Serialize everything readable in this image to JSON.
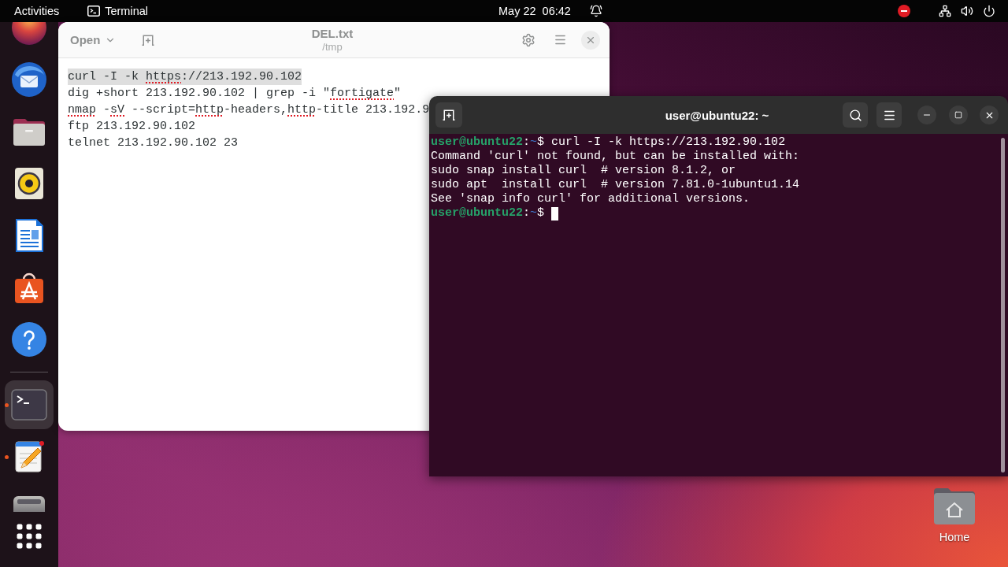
{
  "top_bar": {
    "activities": "Activities",
    "app": "Terminal",
    "date": "May 22",
    "time": "06:42"
  },
  "dock": {
    "pinned": [
      {
        "kind": "orb",
        "running": false,
        "selected": false
      },
      {
        "kind": "mail",
        "running": false,
        "selected": false
      },
      {
        "kind": "folder",
        "running": false,
        "selected": false
      },
      {
        "kind": "speaker",
        "running": false,
        "selected": false
      },
      {
        "kind": "document",
        "running": false,
        "selected": false
      },
      {
        "kind": "store",
        "running": false,
        "selected": false
      },
      {
        "kind": "help",
        "running": false,
        "selected": false
      }
    ],
    "others": [
      {
        "kind": "terminal",
        "running": true,
        "selected": true
      },
      {
        "kind": "notepad",
        "running": true,
        "selected": false
      },
      {
        "kind": "drive",
        "running": false,
        "selected": false
      }
    ]
  },
  "editor": {
    "focused": false,
    "open_button": "Open",
    "title": "DEL.txt",
    "subtitle": "/tmp",
    "lines": [
      {
        "highlighted": true,
        "segments": [
          {
            "text": "curl -I -k ",
            "misspelled": false
          },
          {
            "text": "https",
            "misspelled": true
          },
          {
            "text": "://213.192.90.102",
            "misspelled": false
          }
        ]
      },
      {
        "highlighted": false,
        "segments": [
          {
            "text": "dig +short 213.192.90.102 | grep -i \"",
            "misspelled": false
          },
          {
            "text": "fortigate",
            "misspelled": true
          },
          {
            "text": "\"",
            "misspelled": false
          }
        ]
      },
      {
        "highlighted": false,
        "segments": [
          {
            "text": "nmap",
            "misspelled": true
          },
          {
            "text": " -",
            "misspelled": false
          },
          {
            "text": "sV",
            "misspelled": true
          },
          {
            "text": " --script=",
            "misspelled": false
          },
          {
            "text": "http",
            "misspelled": true
          },
          {
            "text": "-headers,",
            "misspelled": false
          },
          {
            "text": "http",
            "misspelled": true
          },
          {
            "text": "-title 213.192.9",
            "misspelled": false
          }
        ]
      },
      {
        "highlighted": false,
        "segments": [
          {
            "text": "ftp 213.192.90.102",
            "misspelled": false
          }
        ]
      },
      {
        "highlighted": false,
        "segments": [
          {
            "text": "telnet 213.192.90.102 23",
            "misspelled": false
          }
        ]
      }
    ]
  },
  "terminal": {
    "title": "user@ubuntu22: ~",
    "lines": [
      {
        "kind": "prompt",
        "user": "user@ubuntu22",
        "separator": ":",
        "path": "~",
        "symbol": "$",
        "command": "curl -I -k https://213.192.90.102",
        "cursor": false
      },
      {
        "kind": "output",
        "text": "Command 'curl' not found, but can be installed with:"
      },
      {
        "kind": "output",
        "text": "sudo snap install curl  # version 8.1.2, or"
      },
      {
        "kind": "output",
        "text": "sudo apt  install curl  # version 7.81.0-1ubuntu1.14"
      },
      {
        "kind": "output",
        "text": "See 'snap info curl' for additional versions."
      },
      {
        "kind": "prompt",
        "user": "user@ubuntu22",
        "separator": ":",
        "path": "~",
        "symbol": "$",
        "cursor": true
      }
    ]
  },
  "desktop_icons": [
    {
      "label": "Home"
    }
  ]
}
